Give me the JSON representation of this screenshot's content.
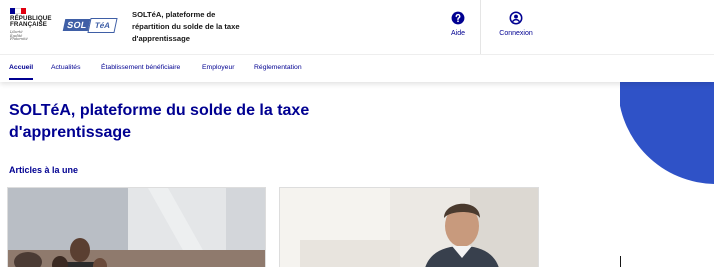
{
  "header": {
    "republique": "RÉPUBLIQUE\nFRANÇAISE",
    "devise": "Liberté\nÉgalité\nFraternité",
    "flag_colors": [
      "#000091",
      "#ffffff",
      "#e1000f"
    ],
    "logo": {
      "part1": "SOL",
      "part2": "TéA"
    },
    "service_title": "SOLTéA, plateforme de répartition du solde de la taxe d'apprentissage",
    "tools": {
      "aide": {
        "label": "Aide",
        "icon": "question-circle-icon"
      },
      "connexion": {
        "label": "Connexion",
        "icon": "account-circle-icon"
      }
    }
  },
  "nav": {
    "items": [
      {
        "label": "Accueil",
        "active": true
      },
      {
        "label": "Actualités",
        "active": false
      },
      {
        "label": "Établissement bénéficiaire",
        "active": false
      },
      {
        "label": "Employeur",
        "active": false
      },
      {
        "label": "Réglementation",
        "active": false
      }
    ]
  },
  "main": {
    "title": "SOLTéA, plateforme du solde de la taxe d'apprentissage",
    "articles_heading": "Articles à la une"
  },
  "colors": {
    "primary": "#000091",
    "logo_blue": "#3f5fa6",
    "decor_blue": "#2f52c7",
    "text": "#161616"
  }
}
